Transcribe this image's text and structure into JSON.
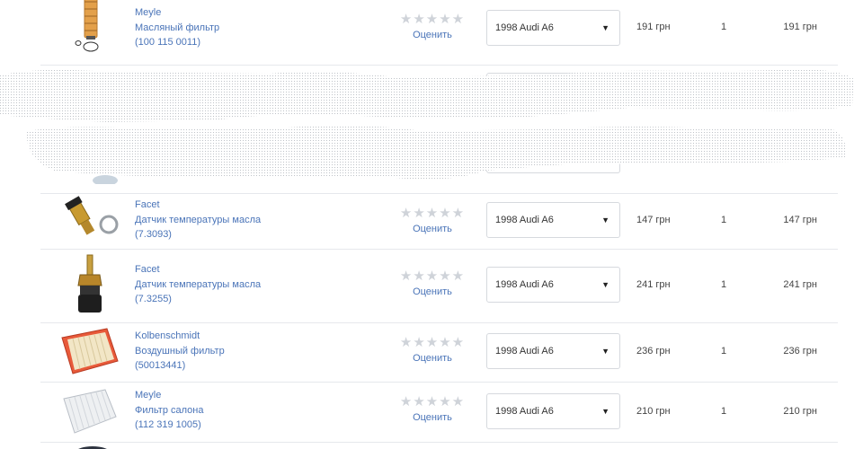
{
  "rows": [
    {
      "brand": "Meyle",
      "name": "Масляный фильтр",
      "code": "(100 115 0011)",
      "rate_label": "Оценить",
      "car": "1998 Audi A6",
      "price": "191 грн",
      "qty": "1",
      "total": "191 грн",
      "thumb_icon": "oil-filter-cartridge-icon"
    },
    {
      "brand": "",
      "name": "",
      "code": "",
      "rate_label": "",
      "car": "",
      "price": "",
      "qty": "",
      "total": "",
      "thumb_icon": "blurred-part-icon"
    },
    {
      "brand": "Facet",
      "name": "Датчик температуры масла",
      "code": "(7.3093)",
      "rate_label": "Оценить",
      "car": "1998 Audi A6",
      "price": "147 грн",
      "qty": "1",
      "total": "147 грн",
      "thumb_icon": "temperature-sensor-icon"
    },
    {
      "brand": "Facet",
      "name": "Датчик температуры масла",
      "code": "(7.3255)",
      "rate_label": "Оценить",
      "car": "1998 Audi A6",
      "price": "241 грн",
      "qty": "1",
      "total": "241 грн",
      "thumb_icon": "temperature-sensor-icon"
    },
    {
      "brand": "Kolbenschmidt",
      "name": "Воздушный фильтр",
      "code": "(50013441)",
      "rate_label": "Оценить",
      "car": "1998 Audi A6",
      "price": "236 грн",
      "qty": "1",
      "total": "236 грн",
      "thumb_icon": "air-filter-icon"
    },
    {
      "brand": "Meyle",
      "name": "Фильтр салона",
      "code": "(112 319 1005)",
      "rate_label": "Оценить",
      "car": "1998 Audi A6",
      "price": "210 грн",
      "qty": "1",
      "total": "210 грн",
      "thumb_icon": "cabin-filter-icon"
    }
  ],
  "stars_glyph": "★★★★★",
  "select_arrow": "▼",
  "colors": {
    "link": "#4a74b8",
    "star": "#cfd3d9",
    "divider": "#e6e8ec"
  }
}
